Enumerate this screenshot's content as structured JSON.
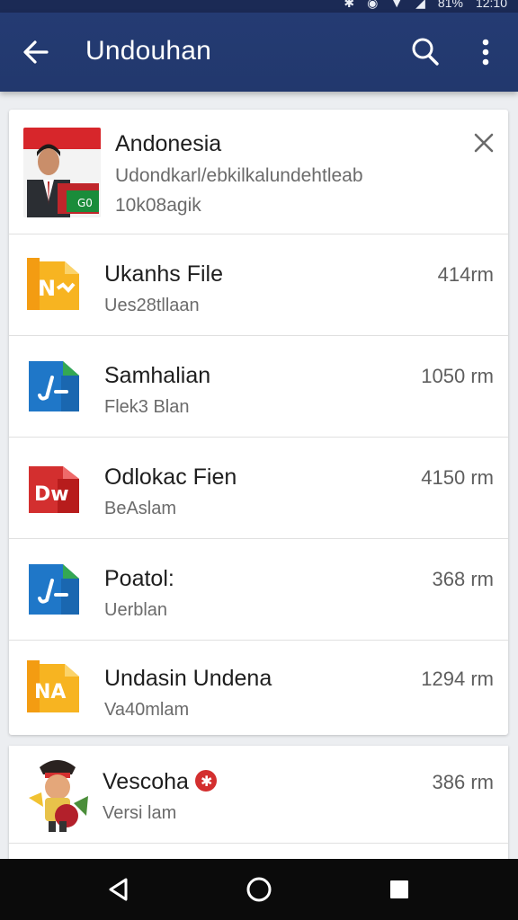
{
  "status_bar": {
    "battery_text": "81%",
    "time": "12:10"
  },
  "app_bar": {
    "title": "Undouhan",
    "back_icon": "arrow-back-icon",
    "search_icon": "search-icon",
    "more_icon": "more-vert-icon"
  },
  "active_download": {
    "title": "Andonesia",
    "path": "Udondkarl/ebkilkalundehtleab",
    "progress_text": "10k08agik",
    "close_icon": "close-icon"
  },
  "downloads": [
    {
      "name": "Ukanhs File",
      "sub": "Ues28tllaan",
      "size": "414rm",
      "icon": "yellow-file-icon",
      "icon_text": "N"
    },
    {
      "name": "Samhalian",
      "sub": "Flek3 Blan",
      "size": "1050 rm",
      "icon": "blue-file-icon",
      "icon_text": "J"
    },
    {
      "name": "Odlokac Fien",
      "sub": "BeAslam",
      "size": "4150 rm",
      "icon": "red-file-icon",
      "icon_text": "DW"
    },
    {
      "name": "Poatol:",
      "sub": "Uerblan",
      "size": "368 rm",
      "icon": "blue-file-icon",
      "icon_text": "J"
    },
    {
      "name": "Undasin Undena",
      "sub": "Va40mlam",
      "size": "1294 rm",
      "icon": "yellow-file-icon",
      "icon_text": "NA"
    }
  ],
  "extra_download": {
    "name": "Vescoha",
    "sub": "Versi lam",
    "size": "386 rm",
    "badge_icon": "red-badge-icon"
  },
  "colors": {
    "app_bar": "#243b73",
    "yellow_icon": "#f7b421",
    "blue_icon": "#1f77c8",
    "green_fold": "#34a853",
    "red_icon": "#d32f2f"
  }
}
